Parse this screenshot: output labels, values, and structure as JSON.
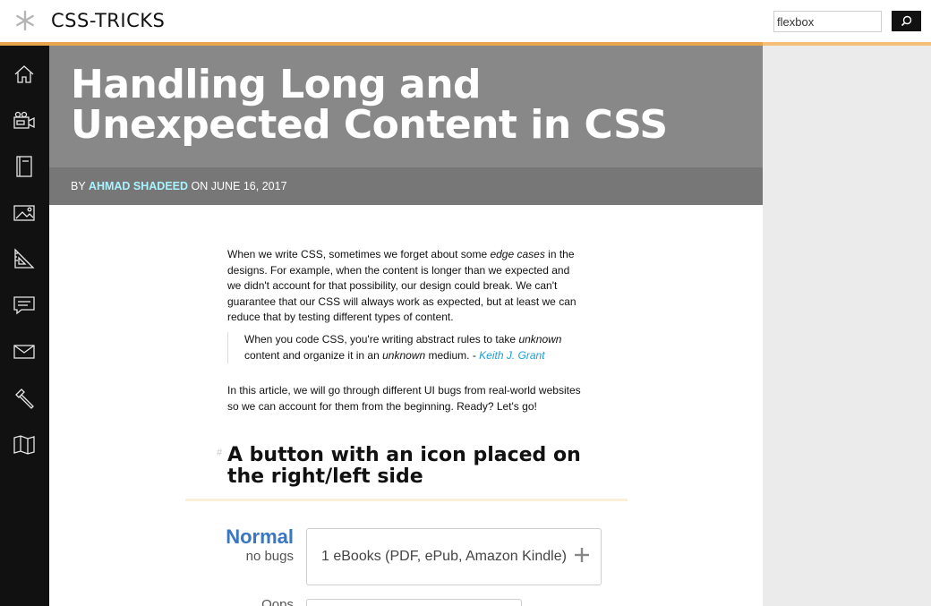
{
  "header": {
    "logo_text": "CSS-TRICKS",
    "logo_icon": "asterisk-star-icon",
    "search_value": "flexbox",
    "search_button_icon": "search-icon",
    "accent_color": "#e8a54c"
  },
  "sidebar": {
    "items": [
      {
        "icon": "home-icon"
      },
      {
        "icon": "video-camera-icon"
      },
      {
        "icon": "book-icon"
      },
      {
        "icon": "image-icon"
      },
      {
        "icon": "ruler-triangle-icon"
      },
      {
        "icon": "comment-icon"
      },
      {
        "icon": "mail-icon"
      },
      {
        "icon": "hammer-icon"
      },
      {
        "icon": "map-icon"
      }
    ]
  },
  "article": {
    "title": "Handling Long and Unexpected Content in CSS",
    "byline_prefix": "BY ",
    "author": "AHMAD SHADEED",
    "byline_suffix": " ON JUNE 16, 2017",
    "para1_a": "When we write CSS, sometimes we forget about some ",
    "para1_em": "edge cases",
    "para1_b": " in the designs. For example, when the content is longer than we expected and we didn't account for that possibility, our design could break. We can't guarantee that our CSS will always work as expected, but at least we can reduce that by testing different types of content.",
    "quote_a": "When you code CSS, you're writing abstract rules to take ",
    "quote_em1": "unknown",
    "quote_b": " content and organize it in an ",
    "quote_em2": "unknown",
    "quote_c": " medium. - ",
    "quote_author": "Keith J. Grant",
    "para2": "In this article, we will go through different UI bugs from real-world websites so we can account for them from the beginning. Ready? Let's go!",
    "section_anchor": "#",
    "section_heading": "A button with an icon placed on the right/left side"
  },
  "demo": {
    "label_big": "Normal",
    "label_small": "no bugs",
    "button_text": "1 eBooks (PDF, ePub, Amazon Kindle)",
    "button_icon": "plus-icon",
    "label2": "Oops"
  }
}
